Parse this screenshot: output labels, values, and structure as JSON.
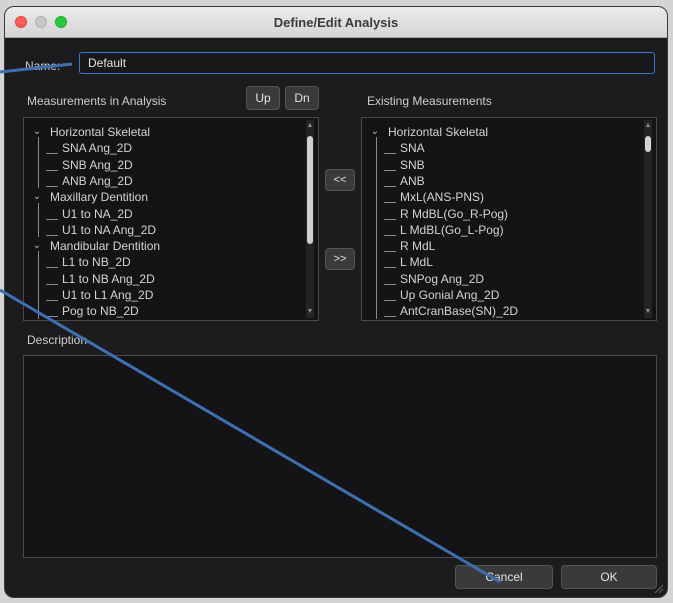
{
  "window": {
    "title": "Define/Edit Analysis"
  },
  "name": {
    "label": "Name:",
    "value": "Default"
  },
  "left_panel": {
    "label": "Measurements in Analysis",
    "up_label": "Up",
    "down_label": "Dn",
    "groups": [
      {
        "title": "Horizontal Skeletal",
        "items": [
          "SNA Ang_2D",
          "SNB Ang_2D",
          "ANB Ang_2D"
        ]
      },
      {
        "title": "Maxillary Dentition",
        "items": [
          "U1 to NA_2D",
          "U1 to NA Ang_2D"
        ]
      },
      {
        "title": "Mandibular Dentition",
        "items": [
          "L1 to NB_2D",
          "L1 to NB Ang_2D",
          "U1 to L1 Ang_2D",
          "Pog to NB_2D"
        ]
      }
    ]
  },
  "transfer": {
    "add_label": "<<",
    "remove_label": ">>"
  },
  "right_panel": {
    "label": "Existing Measurements",
    "groups": [
      {
        "title": "Horizontal Skeletal",
        "items": [
          "SNA",
          "SNB",
          "ANB",
          "MxL(ANS-PNS)",
          "R MdBL(Go_R-Pog)",
          "L MdBL(Go_L-Pog)",
          "R MdL",
          "L MdL",
          "SNPog Ang_2D",
          "Up Gonial Ang_2D",
          "AntCranBase(SN)_2D"
        ]
      }
    ]
  },
  "description": {
    "label": "Description",
    "value": ""
  },
  "footer": {
    "cancel_label": "Cancel",
    "ok_label": "OK"
  },
  "colors": {
    "annotation_line": "#3f6fb0",
    "focus_ring": "#3d78c8"
  },
  "icons": [
    "close-dot",
    "minimize-dot",
    "zoom-dot",
    "chevron-down",
    "scroll-up-arrow",
    "scroll-down-arrow",
    "resize-grip"
  ]
}
